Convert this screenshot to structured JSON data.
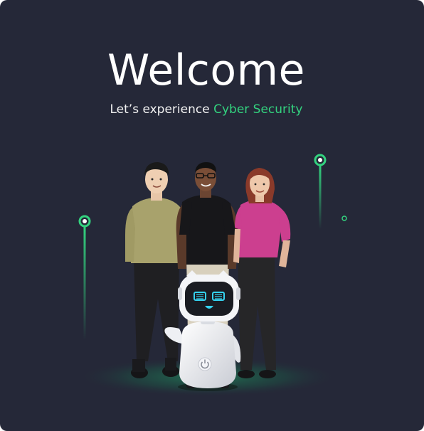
{
  "hero": {
    "title": "Welcome",
    "subtitle_prefix": "Let’s experience ",
    "subtitle_highlight": "Cyber Security"
  },
  "illustration": {
    "icons": [
      "person-icon",
      "person-icon",
      "person-icon",
      "robot-icon",
      "power-icon",
      "glow-node-icon"
    ]
  },
  "colors": {
    "background": "#252838",
    "accent": "#33d37f",
    "robot_face": "#35d3f0"
  }
}
